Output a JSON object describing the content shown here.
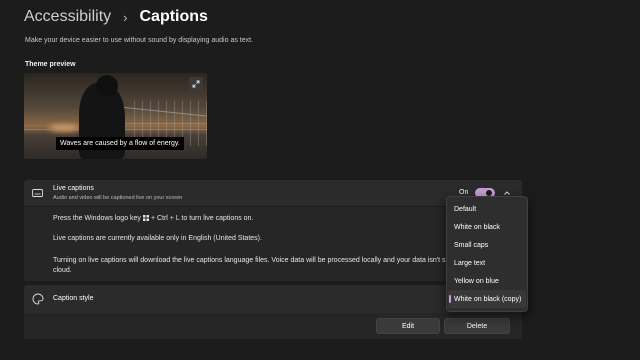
{
  "header": {
    "parent": "Accessibility",
    "separator": "›",
    "current": "Captions",
    "subtitle": "Make your device easier to use without sound by displaying audio as text."
  },
  "preview": {
    "label": "Theme preview",
    "caption_text": "Waves are caused by a flow of energy.",
    "expand_icon": "expand-icon"
  },
  "live_captions": {
    "title": "Live captions",
    "description": "Audio and video will be captioned live on your screen",
    "state": "On",
    "info_1a": "Press the Windows logo key",
    "info_1b": "+ Ctrl + L to turn live captions on.",
    "info_2": "Live captions are currently available only in English (United States).",
    "info_3": "Turning on live captions will download the live captions language files. Voice data will be processed locally and your data isn't sha",
    "info_4": "cloud."
  },
  "caption_style": {
    "label": "Caption style",
    "edit_label": "Edit",
    "delete_label": "Delete"
  },
  "dropdown": {
    "options": [
      "Default",
      "White on black",
      "Small caps",
      "Large text",
      "Yellow on blue",
      "White on black (copy)"
    ],
    "selected": "White on black (copy)"
  },
  "colors": {
    "accent": "#c6a0d6",
    "background": "#1c1c1c",
    "card": "#2b2b2b"
  }
}
